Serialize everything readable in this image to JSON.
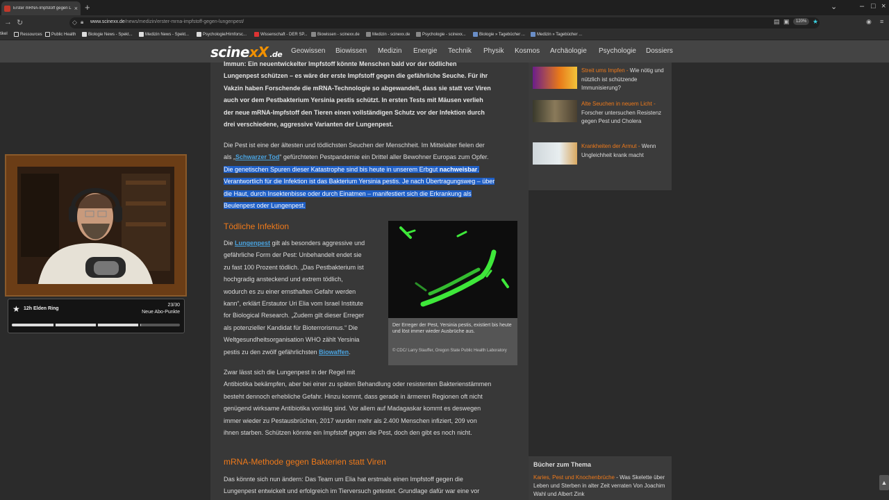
{
  "browser": {
    "tab_title": "Erster mRNA-Impfstoff gegen L",
    "url_domain": "www.scinexx.de",
    "url_path": "/news/medizin/erster-mrna-impfstoff-gegen-lungenpest/",
    "zoom": "120%",
    "bookmarks": [
      "tikel",
      "Ressources",
      "Public Health",
      "Biologie News - Spekt...",
      "Medizin News - Spekt...",
      "Psychologie/Hirnforsc...",
      "Wissenschaft - DER SP...",
      "Biowissen - scinexx.de",
      "Medizin - scinexx.de",
      "Psychologie - scinexx...",
      "Biologie » Tagebücher ...",
      "Medizin » Tagebücher ..."
    ]
  },
  "site": {
    "logo_a": "scine",
    "logo_b": "xX",
    "logo_c": ".de",
    "nav": [
      "Geowissen",
      "Biowissen",
      "Medizin",
      "Energie",
      "Technik",
      "Physik",
      "Kosmos",
      "Archäologie",
      "Psychologie",
      "Dossiers"
    ]
  },
  "article": {
    "lead_lines": [
      "Immun: Ein neuentwickelter Impfstoff könnte Menschen bald vor der tödlichen",
      "Lungenpest schützen – es wäre der erste Impfstoff gegen die gefährliche Seuche. Für ihr",
      "Vakzin haben Forschende die mRNA-Technologie so abgewandelt, dass sie statt vor Viren",
      "auch vor dem Pestbakterium Yersinia pestis schützt. In ersten Tests mit Mäusen verlieh",
      "der neue mRNA-Impfstoff den Tieren einen vollständigen Schutz vor der Infektion durch",
      "drei verschiedene, aggressive Varianten der Lungenpest."
    ],
    "p1_line1": "Die Pest ist eine der ältesten und tödlichsten Seuchen der Menschheit. Im Mittelalter fielen der",
    "p1_line2_a": "als „",
    "p1_link": "Schwarzer Tod",
    "p1_line2_b": "“ gefürchteten Pestpandemie ein Drittel aller Bewohner Europas zum Opfer.",
    "p1_hl_line3_a": "Die genetischen Spuren dieser Katastrophe sind bis heute in unserem Erbgut ",
    "p1_hl_line3_b": "nachweisbar",
    "p1_hl_line3_c": ".",
    "p1_hl_line4": "Verantwortlich für die Infektion ist das Bakterium Yersinia pestis. Je nach Übertragungsweg – über",
    "p1_hl_line5": "die Haut, durch Insektenbisse oder durch Einatmen – manifestiert sich die Erkrankung als",
    "p1_hl_line6": "Beulenpest oder Lungenpest.",
    "h_infection": "Tödliche Infektion",
    "p2_a": "Die ",
    "p2_link": "Lungenpest",
    "p2_lines": [
      " gilt als besonders aggressive und",
      "gefährliche Form der Pest: Unbehandelt endet sie",
      "zu fast 100 Prozent tödlich. „Das Pestbakterium ist",
      "hochgradig ansteckend und extrem tödlich,",
      "wodurch es zu einer ernsthaften Gefahr werden",
      "kann“, erklärt Erstautor Uri Elia vom Israel Institute",
      "for Biological Research. „Zudem gilt dieser Erreger",
      "als potenzieller Kandidat für Bioterrorismus.“ Die",
      "Weltgesundheitsorganisation WHO zählt Yersinia"
    ],
    "p2_last_a": "pestis zu den zwölf gefährlichsten ",
    "p2_last_link": "Biowaffen",
    "p2_last_b": ".",
    "figure_caption": "Der Erreger der Pest, Yersinia pestis, existiert bis heute und löst immer wieder Ausbrüche aus.",
    "figure_credit": "© CDC/ Larry Stauffer, Oregon State Public Health Laboratory",
    "p3_lines": [
      "Zwar lässt sich die Lungenpest in der Regel mit",
      "Antibiotika bekämpfen, aber bei einer zu späten Behandlung oder resistenten Bakterienstämmen",
      "besteht dennoch erhebliche Gefahr. Hinzu kommt, dass gerade in ärmeren Regionen oft nicht",
      "genügend wirksame Antibiotika vorrätig sind. Vor allem auf Madagaskar kommt es deswegen",
      "immer wieder zu Pestausbrüchen,  2017 wurden mehr als 2.400 Menschen infiziert, 209 von",
      "ihnen starben. Schützen könnte ein Impfstoff gegen die Pest, doch den gibt es noch nicht."
    ],
    "h_mrna": "mRNA-Methode gegen Bakterien statt Viren",
    "p4_lines": [
      "Das könnte sich nun ändern: Das Team um Elia hat erstmals einen Impfstoff gegen die",
      "Lungenpest entwickelt und erfolgreich im Tierversuch getestet. Grundlage dafür war eine vor"
    ]
  },
  "sidebar": {
    "items": [
      {
        "title": "Streit ums Impfen",
        "dash": " - ",
        "text": "Wie nötig und nützlich ist schützende Immunisierung?"
      },
      {
        "title": "Alte Seuchen in neuem Licht",
        "dash": " - ",
        "text": "Forscher untersuchen Resistenz gegen Pest und Cholera"
      },
      {
        "title": "Krankheiten der Armut",
        "dash": " - ",
        "text": "Wenn Ungleichheit krank macht"
      }
    ],
    "books_title": "Bücher zum Thema",
    "book_title": "Karies, Pest und Knochenbrüche",
    "book_text": " - Was Skelette über Leben und Sterben in alter Zeit verraten Von Joachim Wahl und Albert Zink"
  },
  "overlay": {
    "sub_title": "12h Elden Ring",
    "sub_count": "23/30",
    "sub_label": "Neue Abo-Punkte",
    "progress": 0.767
  }
}
